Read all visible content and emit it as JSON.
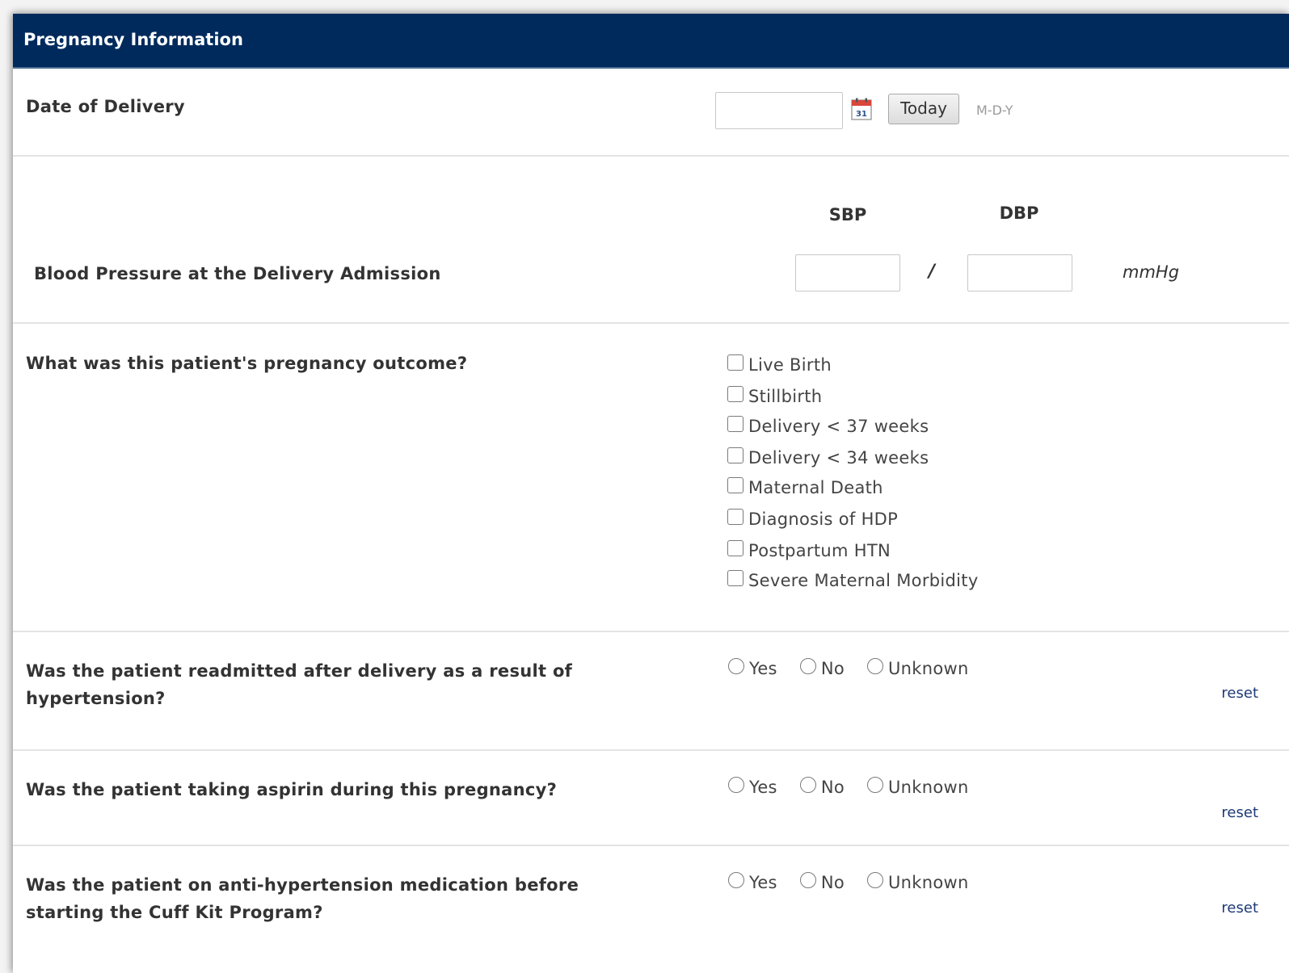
{
  "section": {
    "title": "Pregnancy Information"
  },
  "delivery_date": {
    "label": "Date of Delivery",
    "value": "",
    "today_label": "Today",
    "format_hint": "M-D-Y",
    "calendar_icon": "calendar-icon"
  },
  "blood_pressure": {
    "label": "Blood Pressure at the Delivery Admission",
    "sbp_header": "SBP",
    "dbp_header": "DBP",
    "sbp_value": "",
    "dbp_value": "",
    "separator": "/",
    "unit": "mmHg"
  },
  "outcome": {
    "question": "What was this patient's pregnancy outcome?",
    "options": [
      "Live Birth",
      "Stillbirth",
      "Delivery < 37 weeks",
      "Delivery < 34 weeks",
      "Maternal Death",
      "Diagnosis of HDP",
      "Postpartum HTN",
      "Severe Maternal Morbidity"
    ]
  },
  "questions": [
    {
      "question": "Was the patient readmitted after delivery as a result of hypertension?",
      "options": [
        "Yes",
        "No",
        "Unknown"
      ],
      "reset_label": "reset"
    },
    {
      "question": "Was the patient taking aspirin during this pregnancy?",
      "options": [
        "Yes",
        "No",
        "Unknown"
      ],
      "reset_label": "reset"
    },
    {
      "question": "Was the patient on anti-hypertension medication before starting the Cuff Kit Program?",
      "options": [
        "Yes",
        "No",
        "Unknown"
      ],
      "reset_label": "reset"
    }
  ],
  "colors": {
    "header_bg": "#002a5c",
    "link": "#1e3a78"
  }
}
